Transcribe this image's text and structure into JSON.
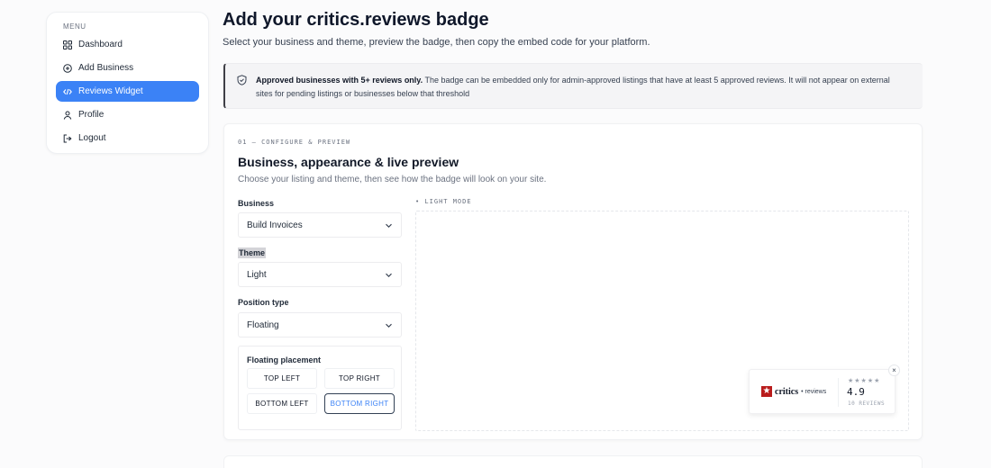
{
  "sidebar": {
    "menu_label": "MENU",
    "items": [
      {
        "label": "Dashboard",
        "icon": "grid-icon"
      },
      {
        "label": "Add Business",
        "icon": "plus-circle-icon"
      },
      {
        "label": "Reviews Widget",
        "icon": "code-icon",
        "active": true
      },
      {
        "label": "Profile",
        "icon": "user-icon"
      },
      {
        "label": "Logout",
        "icon": "logout-icon"
      }
    ]
  },
  "header": {
    "title": "Add your critics.reviews badge",
    "subtitle": "Select your business and theme, preview the badge, then copy the embed code for your platform."
  },
  "notice": {
    "bold": "Approved businesses with 5+ reviews only.",
    "text": " The badge can be embedded only for admin-approved listings that have at least 5 approved reviews. It will not appear on external sites for pending listings or businesses below that threshold"
  },
  "configure": {
    "step_label": "01 — CONFIGURE & PREVIEW",
    "title": "Business, appearance & live preview",
    "subtitle": "Choose your listing and theme, then see how the badge will look on your site.",
    "business_label": "Business",
    "business_value": "Build Invoices",
    "theme_label": "Theme",
    "theme_value": "Light",
    "position_label": "Position type",
    "position_value": "Floating",
    "placement_label": "Floating placement",
    "placements": [
      "TOP LEFT",
      "TOP RIGHT",
      "BOTTOM LEFT",
      "BOTTOM RIGHT"
    ],
    "active_placement": "BOTTOM RIGHT",
    "preview_label": "• LIGHT MODE"
  },
  "badge": {
    "brand": "critics",
    "suffix": "• reviews",
    "stars": "★★★★★",
    "rating": "4.9",
    "count": "10 REVIEWS",
    "close": "×"
  },
  "colors": {
    "accent": "#3b82f6",
    "brand_red": "#b91c1c"
  }
}
